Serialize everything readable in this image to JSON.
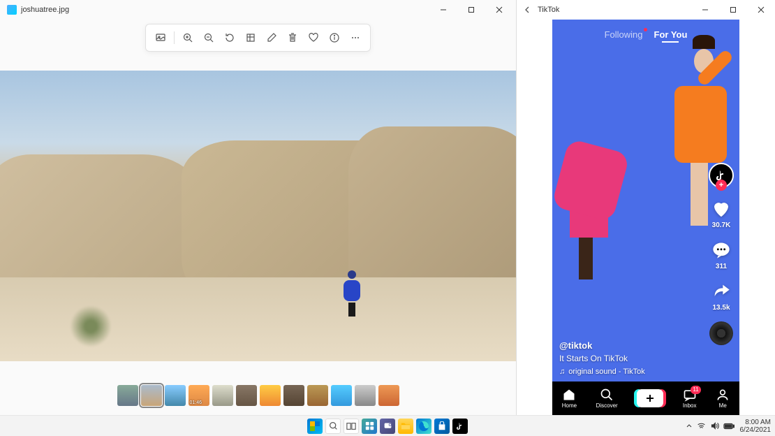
{
  "photos": {
    "title": "joshuatree.jpg",
    "thumbnails": [
      {
        "class": "t1"
      },
      {
        "class": "t2",
        "active": true
      },
      {
        "class": "t3"
      },
      {
        "class": "t4",
        "duration": "01:46"
      },
      {
        "class": "t5"
      },
      {
        "class": "t6"
      },
      {
        "class": "t7"
      },
      {
        "class": "t8"
      },
      {
        "class": "t9"
      },
      {
        "class": "t10"
      },
      {
        "class": "t11"
      },
      {
        "class": "t12"
      }
    ]
  },
  "tiktok": {
    "title": "TikTok",
    "tabs": {
      "following": "Following",
      "foryou": "For You"
    },
    "video": {
      "user": "@tiktok",
      "caption": "It Starts On TikTok",
      "sound": "original sound - TikTok"
    },
    "counts": {
      "likes": "30.7K",
      "comments": "311",
      "shares": "13.5k"
    },
    "nav": {
      "home": "Home",
      "discover": "Discover",
      "inbox": "Inbox",
      "inbox_badge": "11",
      "me": "Me"
    }
  },
  "system": {
    "time": "8:00 AM",
    "date": "6/24/2021"
  }
}
